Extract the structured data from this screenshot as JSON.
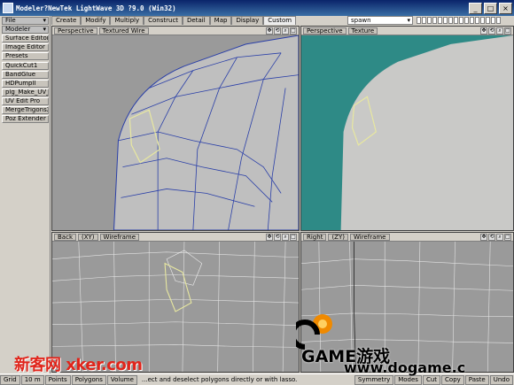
{
  "window": {
    "title": "Modeler?NewTek LightWave 3D ?9.0 (Win32)",
    "min": "_",
    "max": "□",
    "close": "×"
  },
  "sidebar": {
    "file_menu": "File",
    "modeler_menu": "Modeler",
    "buttons": [
      "Surface Editor",
      "Image Editor",
      "Presets"
    ],
    "plugins": [
      "QuickCut1",
      "BandGlue",
      "HDPumpII",
      "plg_Make_UV_",
      "UV Edit Pro",
      "MergeTrigonsX",
      "Poz Extender"
    ]
  },
  "tabs": [
    "Create",
    "Modify",
    "Multiply",
    "Construct",
    "Detail",
    "Map",
    "Display",
    "Custom"
  ],
  "active_tab": "Custom",
  "object_combo": "spawn",
  "viewports": {
    "top_left": {
      "view": "Perspective",
      "mode": "Textured Wire"
    },
    "top_right": {
      "view": "Perspective",
      "mode": "Texture"
    },
    "bottom_left": {
      "view": "Back",
      "axis": "(XY)",
      "mode": "Wireframe"
    },
    "bottom_right": {
      "view": "Right",
      "axis": "(ZY)",
      "mode": "Wireframe"
    }
  },
  "icons": {
    "move": "✥",
    "rotate": "⟲",
    "zoom": "🔍",
    "maximize": "□"
  },
  "statusbar": {
    "grid": "Grid",
    "grid_value": "10 m",
    "points": "Points",
    "polygons": "Polygons",
    "volume": "Volume",
    "help": "...ect and deselect polygons directly or with lasso.",
    "symmetry": "Symmetry",
    "modes": "Modes",
    "cut": "Cut",
    "copy": "Copy",
    "paste": "Paste",
    "undo": "Undo"
  },
  "watermarks": {
    "left": "新客网 xker.com",
    "right_brand": "GAME游戏",
    "right_url": "www.dogame.c"
  },
  "colors": {
    "title_bar": "#0a246a",
    "viewport_bg": "#9a9a9a",
    "texture_bg": "#2e8a86",
    "wire": "#2a3fa8",
    "selection": "#e8e8a0",
    "watermark_red": "#e0251b"
  }
}
